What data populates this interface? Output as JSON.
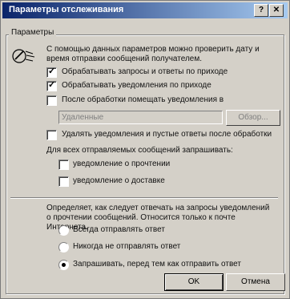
{
  "window": {
    "title": "Параметры отслеживания",
    "help_glyph": "?",
    "close_glyph": "✕"
  },
  "group": {
    "label": "Параметры",
    "description": "С помощью данных параметров можно проверить дату и время отправки сообщений получателем.",
    "options": [
      {
        "label": "Обрабатывать запросы и ответы по приходе",
        "checked": true
      },
      {
        "label": "Обрабатывать уведомления по приходе",
        "checked": true
      },
      {
        "label": "После обработки помещать уведомления в",
        "checked": false
      },
      {
        "label": "Удалять уведомления и пустые ответы после обработки",
        "checked": false
      }
    ],
    "folder": {
      "value": "Удаленные",
      "browse_label": "Обзор..."
    },
    "request_caption": "Для всех отправляемых сообщений запрашивать:",
    "requests": [
      {
        "label": "уведомление о прочтении",
        "checked": false
      },
      {
        "label": "уведомление о доставке",
        "checked": false
      }
    ],
    "reply_description": "Определяет, как следует отвечать на запросы уведомлений о прочтении сообщений. Относится только к почте Интернета.",
    "reply_options": [
      {
        "label": "Всегда отправлять ответ",
        "selected": false
      },
      {
        "label": "Никогда не отправлять ответ",
        "selected": false
      },
      {
        "label": "Запрашивать, перед тем как отправить ответ",
        "selected": true
      }
    ]
  },
  "buttons": {
    "ok": "OK",
    "cancel": "Отмена"
  }
}
